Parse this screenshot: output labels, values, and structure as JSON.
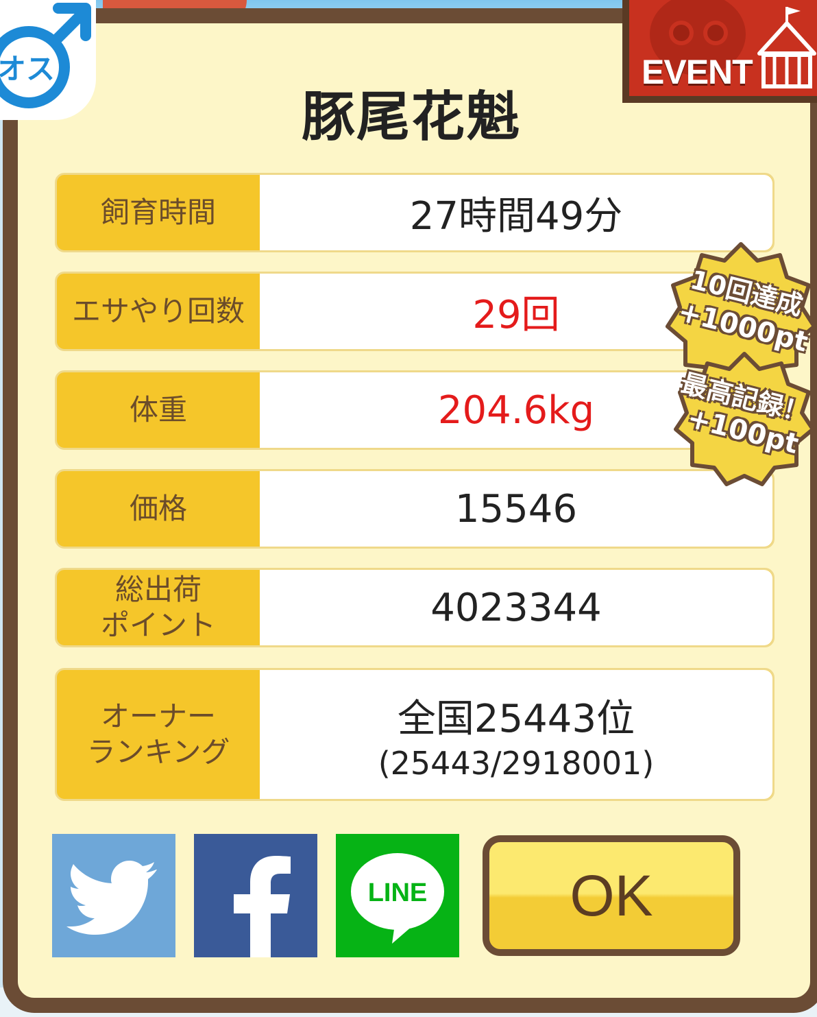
{
  "title": "豚尾花魁",
  "gender_badge": {
    "text": "オス",
    "icon": "male-symbol-icon"
  },
  "event_banner": {
    "label": "EVENT"
  },
  "rows": [
    {
      "label": "飼育時間",
      "value": "27時間49分",
      "sub": "",
      "highlight": false
    },
    {
      "label": "エサやり回数",
      "value": "29回",
      "sub": "",
      "highlight": true
    },
    {
      "label": "体重",
      "value": "204.6kg",
      "sub": "",
      "highlight": true
    },
    {
      "label": "価格",
      "value": "15546",
      "sub": "",
      "highlight": false
    },
    {
      "label": "総出荷\nポイント",
      "value": "4023344",
      "sub": "",
      "highlight": false
    },
    {
      "label": "オーナー\nランキング",
      "value": "全国25443位",
      "sub": "(25443/2918001)",
      "highlight": false
    }
  ],
  "badges": [
    {
      "line1": "10回達成",
      "line2": "+1000pt"
    },
    {
      "line1": "最高記録！",
      "line2": "+100pt"
    }
  ],
  "share": {
    "twitter_icon": "twitter-icon",
    "facebook_icon": "facebook-icon",
    "line_label": "LINE"
  },
  "ok_label": "OK",
  "colors": {
    "frame": "#6b4c35",
    "panel": "#fdf6c8",
    "label_bg": "#f5c62a",
    "highlight_text": "#e41b1b",
    "twitter": "#6ea7d8",
    "facebook": "#3a5a98",
    "line": "#06b315"
  }
}
